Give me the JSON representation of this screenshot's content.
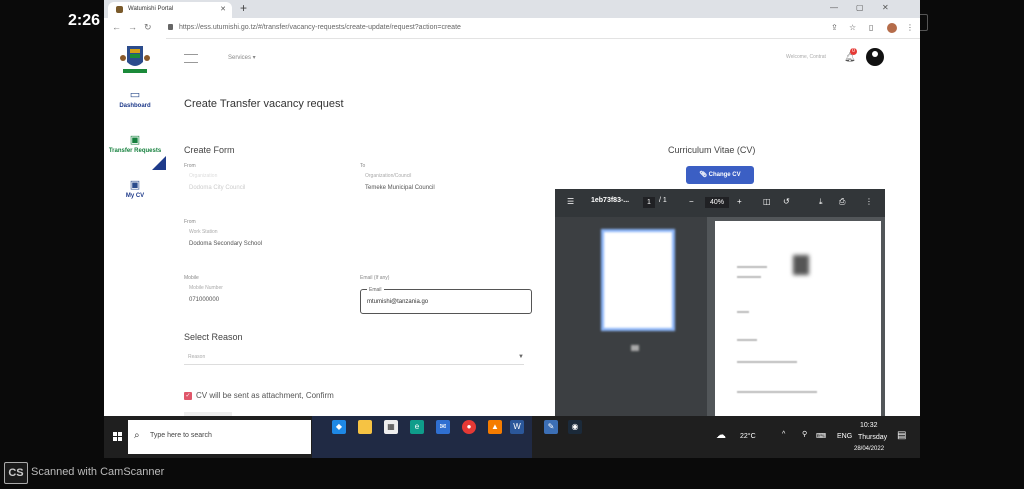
{
  "status_bar": {
    "time": "2:26"
  },
  "browser": {
    "tab_title": "Watumishi Portal",
    "url": "https://ess.utumishi.go.tz/#/transfer/vacancy-requests/create-update/request?action=create"
  },
  "sidebar": {
    "items": [
      {
        "label": "Dashboard",
        "icon": "monitor-icon"
      },
      {
        "label": "Transfer Requests",
        "icon": "briefcase-icon",
        "active": true
      },
      {
        "label": "My CV",
        "icon": "briefcase-icon"
      }
    ]
  },
  "topnav": {
    "services_label": "Services",
    "welcome": "Welcome, Contrat",
    "notification_count": "0"
  },
  "page": {
    "title": "Create Transfer vacancy request"
  },
  "form": {
    "section": "Create Form",
    "from_label": "From",
    "from_org_label": "Organization",
    "from_org_value": "Dodoma City Council",
    "to_label": "To",
    "to_org_label": "Organization/Council",
    "to_org_value": "Temeke Municipal Council",
    "from2_label": "From",
    "work_station_label": "Work Station",
    "work_station_value": "Dodoma Secondary School",
    "mobile_label": "Mobile",
    "mobile_sub_label": "Mobile Number",
    "mobile_value": "071000000",
    "email_label": "Email (If any)",
    "email_sub_label": "Email",
    "email_value": "mtumishi@tanzania.go",
    "reason_section": "Select Reason",
    "reason_placeholder": "Reason",
    "cv_confirm": "CV will be sent as attachment, Confirm"
  },
  "cv": {
    "title": "Curriculum Vitae (CV)",
    "change_button": "Change CV",
    "pdf_filename": "1eb73f83-...",
    "page_current": "1",
    "page_total": "/ 1",
    "zoom": "40%"
  },
  "taskbar": {
    "search_placeholder": "Type here to search",
    "temperature": "22°C",
    "language": "ENG",
    "clock_time": "10:32",
    "clock_day": "Thursday",
    "clock_date": "28/04/2022"
  },
  "watermark": {
    "logo": "CS",
    "text": "Scanned with CamScanner"
  }
}
